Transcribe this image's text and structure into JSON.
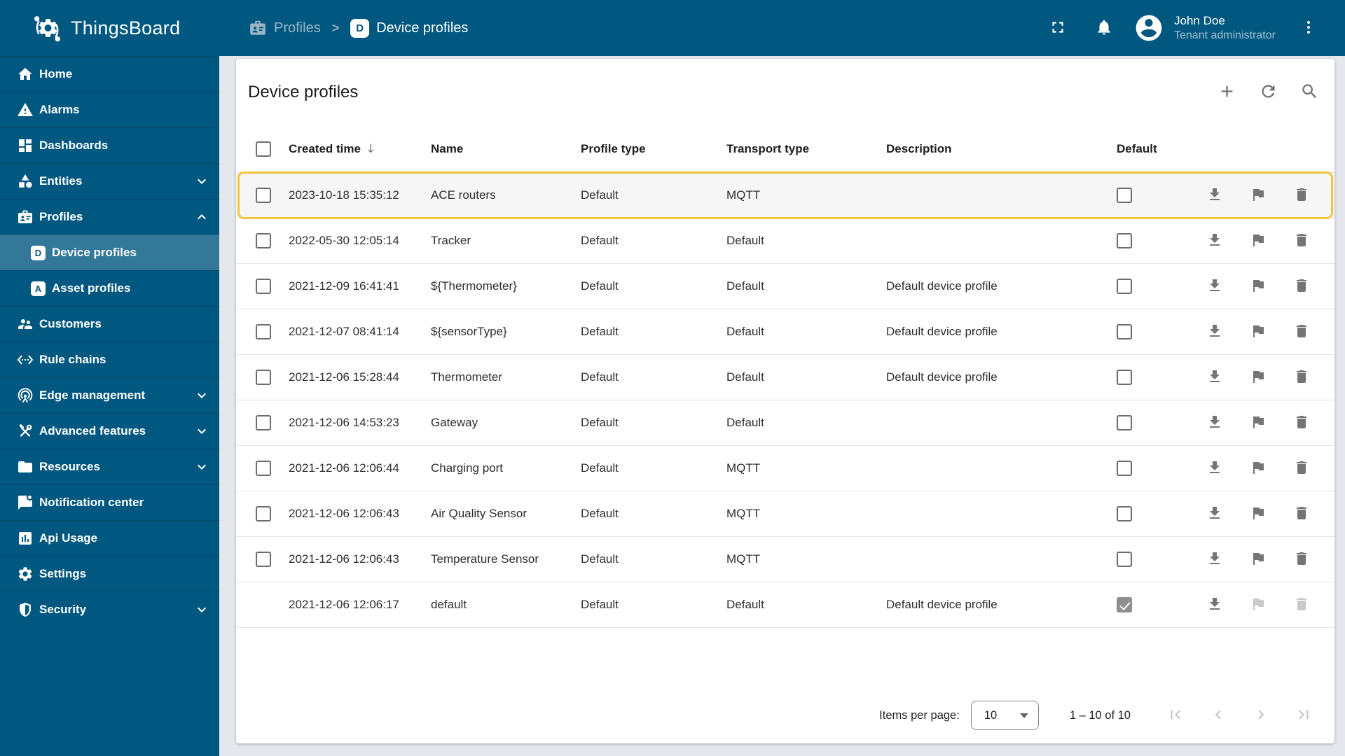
{
  "brand": {
    "name": "ThingsBoard"
  },
  "breadcrumb": {
    "separator": ">",
    "items": [
      {
        "label": "Profiles",
        "icon": "badge-icon"
      },
      {
        "label": "Device profiles",
        "icon": "device-profile-letter-icon",
        "letter": "D"
      }
    ]
  },
  "topbar": {
    "user": {
      "name": "John Doe",
      "role": "Tenant administrator"
    },
    "icons": [
      "fullscreen-icon",
      "bell-icon",
      "avatar-icon",
      "kebab-menu-icon"
    ]
  },
  "sidebar": {
    "items": [
      {
        "label": "Home",
        "icon": "home-icon"
      },
      {
        "label": "Alarms",
        "icon": "alarms-icon"
      },
      {
        "label": "Dashboards",
        "icon": "dashboards-icon"
      },
      {
        "label": "Entities",
        "icon": "entities-icon",
        "chevron": "down"
      },
      {
        "label": "Profiles",
        "icon": "profiles-icon",
        "chevron": "up"
      },
      {
        "label": "Device profiles",
        "letter": "D",
        "sub": true,
        "selected": true
      },
      {
        "label": "Asset profiles",
        "letter": "A",
        "sub": true
      },
      {
        "label": "Customers",
        "icon": "customers-icon"
      },
      {
        "label": "Rule chains",
        "icon": "rule-chains-icon"
      },
      {
        "label": "Edge management",
        "icon": "edge-management-icon",
        "chevron": "down"
      },
      {
        "label": "Advanced features",
        "icon": "advanced-features-icon",
        "chevron": "down"
      },
      {
        "label": "Resources",
        "icon": "resources-icon",
        "chevron": "down"
      },
      {
        "label": "Notification center",
        "icon": "notification-center-icon"
      },
      {
        "label": "Api Usage",
        "icon": "api-usage-icon"
      },
      {
        "label": "Settings",
        "icon": "settings-icon"
      },
      {
        "label": "Security",
        "icon": "security-icon",
        "chevron": "down"
      }
    ]
  },
  "page": {
    "title": "Device profiles"
  },
  "toolbar": {
    "icons": [
      "add-icon",
      "refresh-icon",
      "search-icon"
    ]
  },
  "table": {
    "columns": [
      "Created time",
      "Name",
      "Profile type",
      "Transport type",
      "Description",
      "Default"
    ],
    "sort": {
      "column": "Created time",
      "direction": "desc",
      "indicator": "↓"
    },
    "rows": [
      {
        "created_time": "2023-10-18 15:35:12",
        "name": "ACE routers",
        "profile_type": "Default",
        "transport_type": "MQTT",
        "description": "",
        "default": false,
        "highlighted": true,
        "selectable": true,
        "actions": {
          "download": true,
          "flag": true,
          "delete": true
        }
      },
      {
        "created_time": "2022-05-30 12:05:14",
        "name": "Tracker",
        "profile_type": "Default",
        "transport_type": "Default",
        "description": "",
        "default": false,
        "highlighted": false,
        "selectable": true,
        "actions": {
          "download": true,
          "flag": true,
          "delete": true
        }
      },
      {
        "created_time": "2021-12-09 16:41:41",
        "name": "${Thermometer}",
        "profile_type": "Default",
        "transport_type": "Default",
        "description": "Default device profile",
        "default": false,
        "highlighted": false,
        "selectable": true,
        "actions": {
          "download": true,
          "flag": true,
          "delete": true
        }
      },
      {
        "created_time": "2021-12-07 08:41:14",
        "name": "${sensorType}",
        "profile_type": "Default",
        "transport_type": "Default",
        "description": "Default device profile",
        "default": false,
        "highlighted": false,
        "selectable": true,
        "actions": {
          "download": true,
          "flag": true,
          "delete": true
        }
      },
      {
        "created_time": "2021-12-06 15:28:44",
        "name": "Thermometer",
        "profile_type": "Default",
        "transport_type": "Default",
        "description": "Default device profile",
        "default": false,
        "highlighted": false,
        "selectable": true,
        "actions": {
          "download": true,
          "flag": true,
          "delete": true
        }
      },
      {
        "created_time": "2021-12-06 14:53:23",
        "name": "Gateway",
        "profile_type": "Default",
        "transport_type": "Default",
        "description": "",
        "default": false,
        "highlighted": false,
        "selectable": true,
        "actions": {
          "download": true,
          "flag": true,
          "delete": true
        }
      },
      {
        "created_time": "2021-12-06 12:06:44",
        "name": "Charging port",
        "profile_type": "Default",
        "transport_type": "MQTT",
        "description": "",
        "default": false,
        "highlighted": false,
        "selectable": true,
        "actions": {
          "download": true,
          "flag": true,
          "delete": true
        }
      },
      {
        "created_time": "2021-12-06 12:06:43",
        "name": "Air Quality Sensor",
        "profile_type": "Default",
        "transport_type": "MQTT",
        "description": "",
        "default": false,
        "highlighted": false,
        "selectable": true,
        "actions": {
          "download": true,
          "flag": true,
          "delete": true
        }
      },
      {
        "created_time": "2021-12-06 12:06:43",
        "name": "Temperature Sensor",
        "profile_type": "Default",
        "transport_type": "MQTT",
        "description": "",
        "default": false,
        "highlighted": false,
        "selectable": true,
        "actions": {
          "download": true,
          "flag": true,
          "delete": true
        }
      },
      {
        "created_time": "2021-12-06 12:06:17",
        "name": "default",
        "profile_type": "Default",
        "transport_type": "Default",
        "description": "Default device profile",
        "default": true,
        "highlighted": false,
        "selectable": false,
        "actions": {
          "download": true,
          "flag": false,
          "delete": false
        }
      }
    ]
  },
  "pagination": {
    "items_per_page_label": "Items per page:",
    "page_size": "10",
    "range": "1 – 10 of 10"
  },
  "colors": {
    "primary": "#005780",
    "highlight_border": "#F2C53D",
    "icon_gray": "#757575"
  }
}
